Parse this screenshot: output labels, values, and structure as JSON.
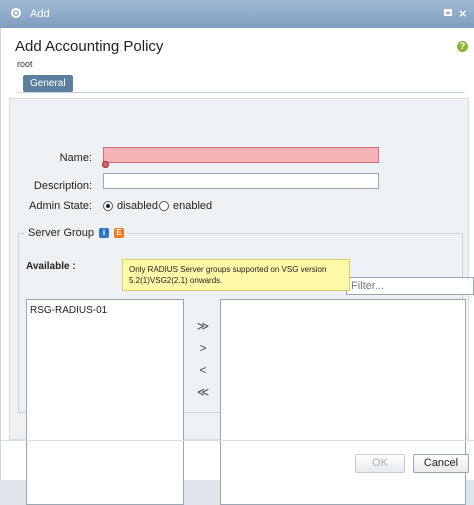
{
  "window": {
    "title": "Add"
  },
  "dialog": {
    "heading": "Add Accounting Policy",
    "subtitle": "root",
    "help_symbol": "?"
  },
  "tabs": [
    {
      "label": "General"
    }
  ],
  "form": {
    "name_label": "Name:",
    "name_value": "",
    "description_label": "Description:",
    "description_value": "",
    "admin_state_label": "Admin State:",
    "admin_state_options": [
      "disabled",
      "enabled"
    ],
    "admin_state_selected": "disabled"
  },
  "server_group": {
    "title": "Server Group",
    "info_symbol": "i",
    "orange_symbol": "E",
    "available_label": "Available :",
    "tooltip": "Only RADIUS Server groups supported on VSG version 5.2(1)VSG2(2.1) onwards.",
    "filter_placeholder": "Filter...",
    "available_items": [
      "RSG-RADIUS-01"
    ],
    "selected_items": [],
    "arrows": [
      "≫",
      ">",
      "<",
      "≪"
    ]
  },
  "buttons": {
    "ok": "OK",
    "cancel": "Cancel"
  },
  "colors": {
    "titlebar": "#8faed0",
    "tab": "#5d7f9f",
    "error_field": "#f7b4b8",
    "tooltip": "#fffaa8"
  }
}
